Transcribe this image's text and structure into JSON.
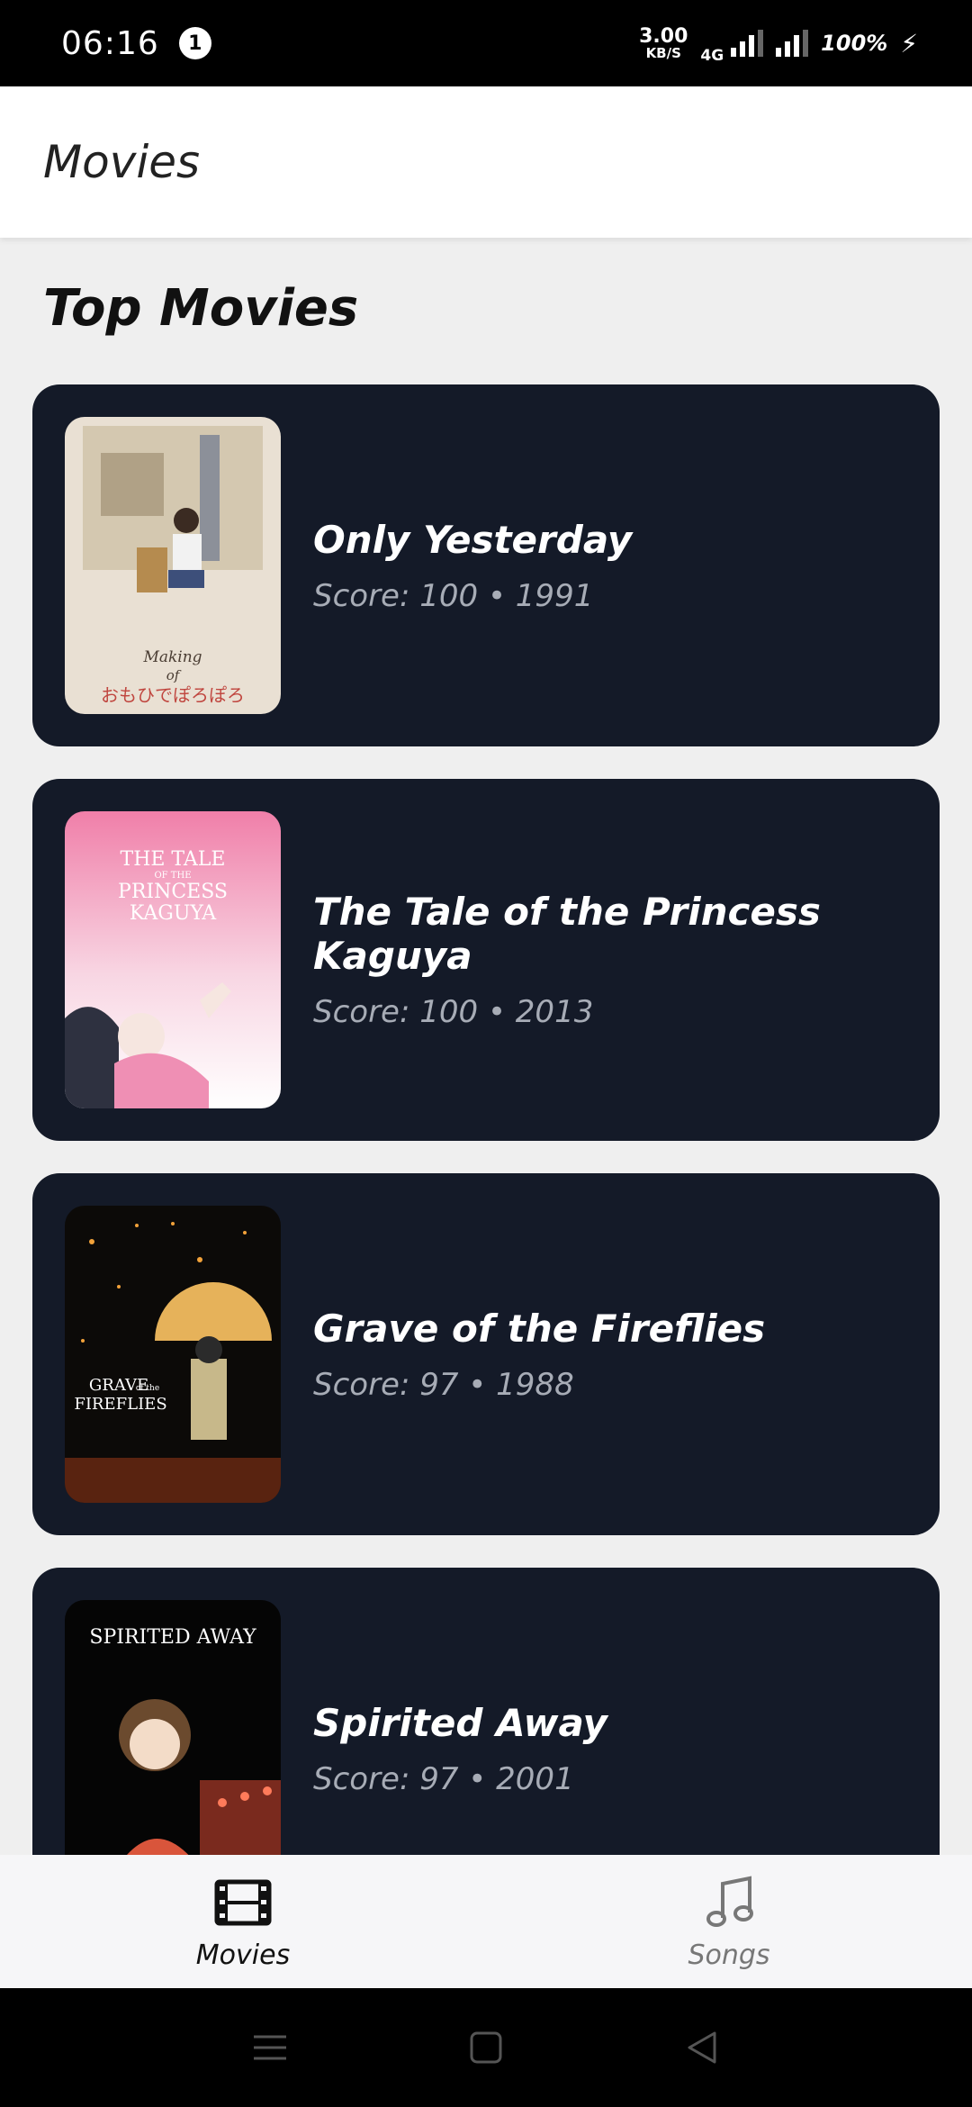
{
  "status_bar": {
    "time": "06:16",
    "notification_count": "1",
    "net_speed_value": "3.00",
    "net_speed_unit": "KB/S",
    "network_type": "4G",
    "battery": "100%"
  },
  "app_bar": {
    "title": "Movies"
  },
  "section": {
    "title": "Top Movies"
  },
  "movies": [
    {
      "title": "Only Yesterday",
      "meta": "Score: 100 • 1991",
      "poster_text_1": "Making",
      "poster_text_2": "of",
      "poster_text_3": "おもひでぽろぽろ"
    },
    {
      "title": "The Tale of the Princess Kaguya",
      "meta": "Score: 100 • 2013",
      "poster_text_1": "THE TALE",
      "poster_text_2": "OF THE",
      "poster_text_3": "PRINCESS",
      "poster_text_4": "KAGUYA"
    },
    {
      "title": "Grave of the Fireflies",
      "meta": "Score: 97 • 1988",
      "poster_text_1": "GRAVE",
      "poster_text_2": "of the",
      "poster_text_3": "FIREFLIES"
    },
    {
      "title": "Spirited Away",
      "meta": "Score: 97 • 2001",
      "poster_text_1": "SPIRITED AWAY"
    }
  ],
  "bottom_nav": {
    "movies_label": "Movies",
    "songs_label": "Songs",
    "active": "movies"
  },
  "colors": {
    "card_bg": "#141a28",
    "meta_text": "#a7acb6",
    "page_bg": "#efefef"
  },
  "icons": {
    "movies_tab": "film-icon",
    "songs_tab": "music-note-icon",
    "sys_menu": "menu-icon",
    "sys_home": "home-square-icon",
    "sys_back": "back-triangle-icon"
  }
}
